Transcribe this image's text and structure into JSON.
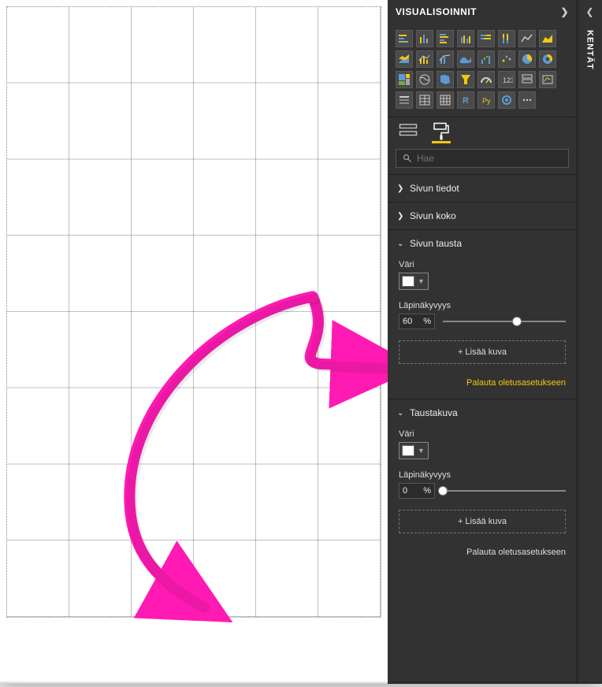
{
  "visualizations": {
    "title": "VISUALISOINNIT",
    "search_placeholder": "Hae"
  },
  "fields": {
    "title": "KENTÄT"
  },
  "sections": {
    "page_info": {
      "label": "Sivun tiedot",
      "expanded": false
    },
    "page_size": {
      "label": "Sivun koko",
      "expanded": false
    },
    "page_background": {
      "label": "Sivun tausta",
      "expanded": true,
      "color_label": "Väri",
      "transparency_label": "Läpinäkyvyys",
      "transparency_value": "60",
      "transparency_unit": "%",
      "add_image_label": "+ Lisää kuva",
      "reset_label": "Palauta oletusasetukseen"
    },
    "wallpaper": {
      "label": "Taustakuva",
      "expanded": true,
      "color_label": "Väri",
      "transparency_label": "Läpinäkyvyys",
      "transparency_value": "0",
      "transparency_unit": "%",
      "add_image_label": "+ Lisää kuva",
      "reset_label": "Palauta oletusasetukseen"
    }
  },
  "viz_icons": [
    "stacked-bar",
    "stacked-column",
    "clustered-bar",
    "clustered-column",
    "100-stacked-bar",
    "100-stacked-column",
    "line",
    "area",
    "stacked-area",
    "line-clustered-column",
    "line-stacked-column",
    "ribbon",
    "waterfall",
    "scatter",
    "pie",
    "donut",
    "treemap",
    "map",
    "filled-map",
    "funnel",
    "gauge",
    "card",
    "multi-row-card",
    "kpi",
    "slicer",
    "table",
    "matrix",
    "r-visual",
    "python-visual",
    "arcgis",
    "more"
  ]
}
